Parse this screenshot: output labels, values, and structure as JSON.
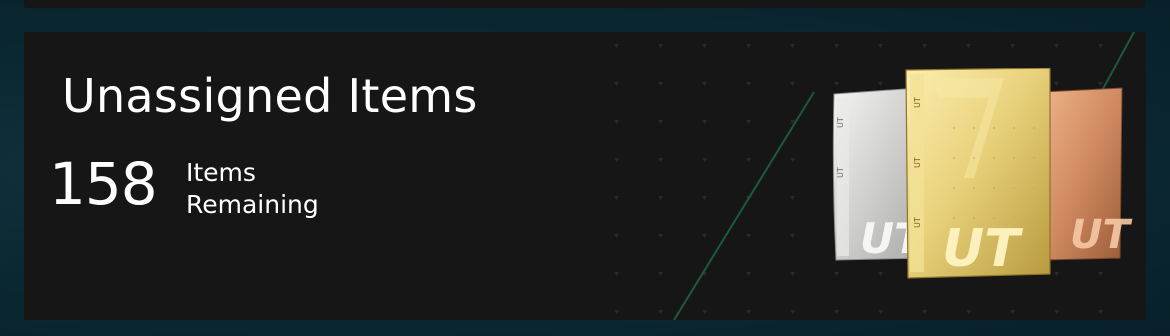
{
  "card": {
    "title": "Unassigned Items",
    "count": "158",
    "count_label_line1": "Items",
    "count_label_line2": "Remaining"
  },
  "packs": {
    "items": [
      {
        "name": "silver-pack",
        "color": "#d8d8d6",
        "logo": "UT",
        "side_text": "UT"
      },
      {
        "name": "bronze-pack",
        "color": "#cf8a60",
        "logo": "UT",
        "side_text": "UT"
      },
      {
        "name": "gold-pack",
        "color": "#e9d27c",
        "logo": "UT",
        "side_text": "UT"
      }
    ]
  },
  "colors": {
    "background": "#0b2a33",
    "card": "#161616",
    "accent_line": "#1f6b45",
    "text": "#ffffff"
  }
}
